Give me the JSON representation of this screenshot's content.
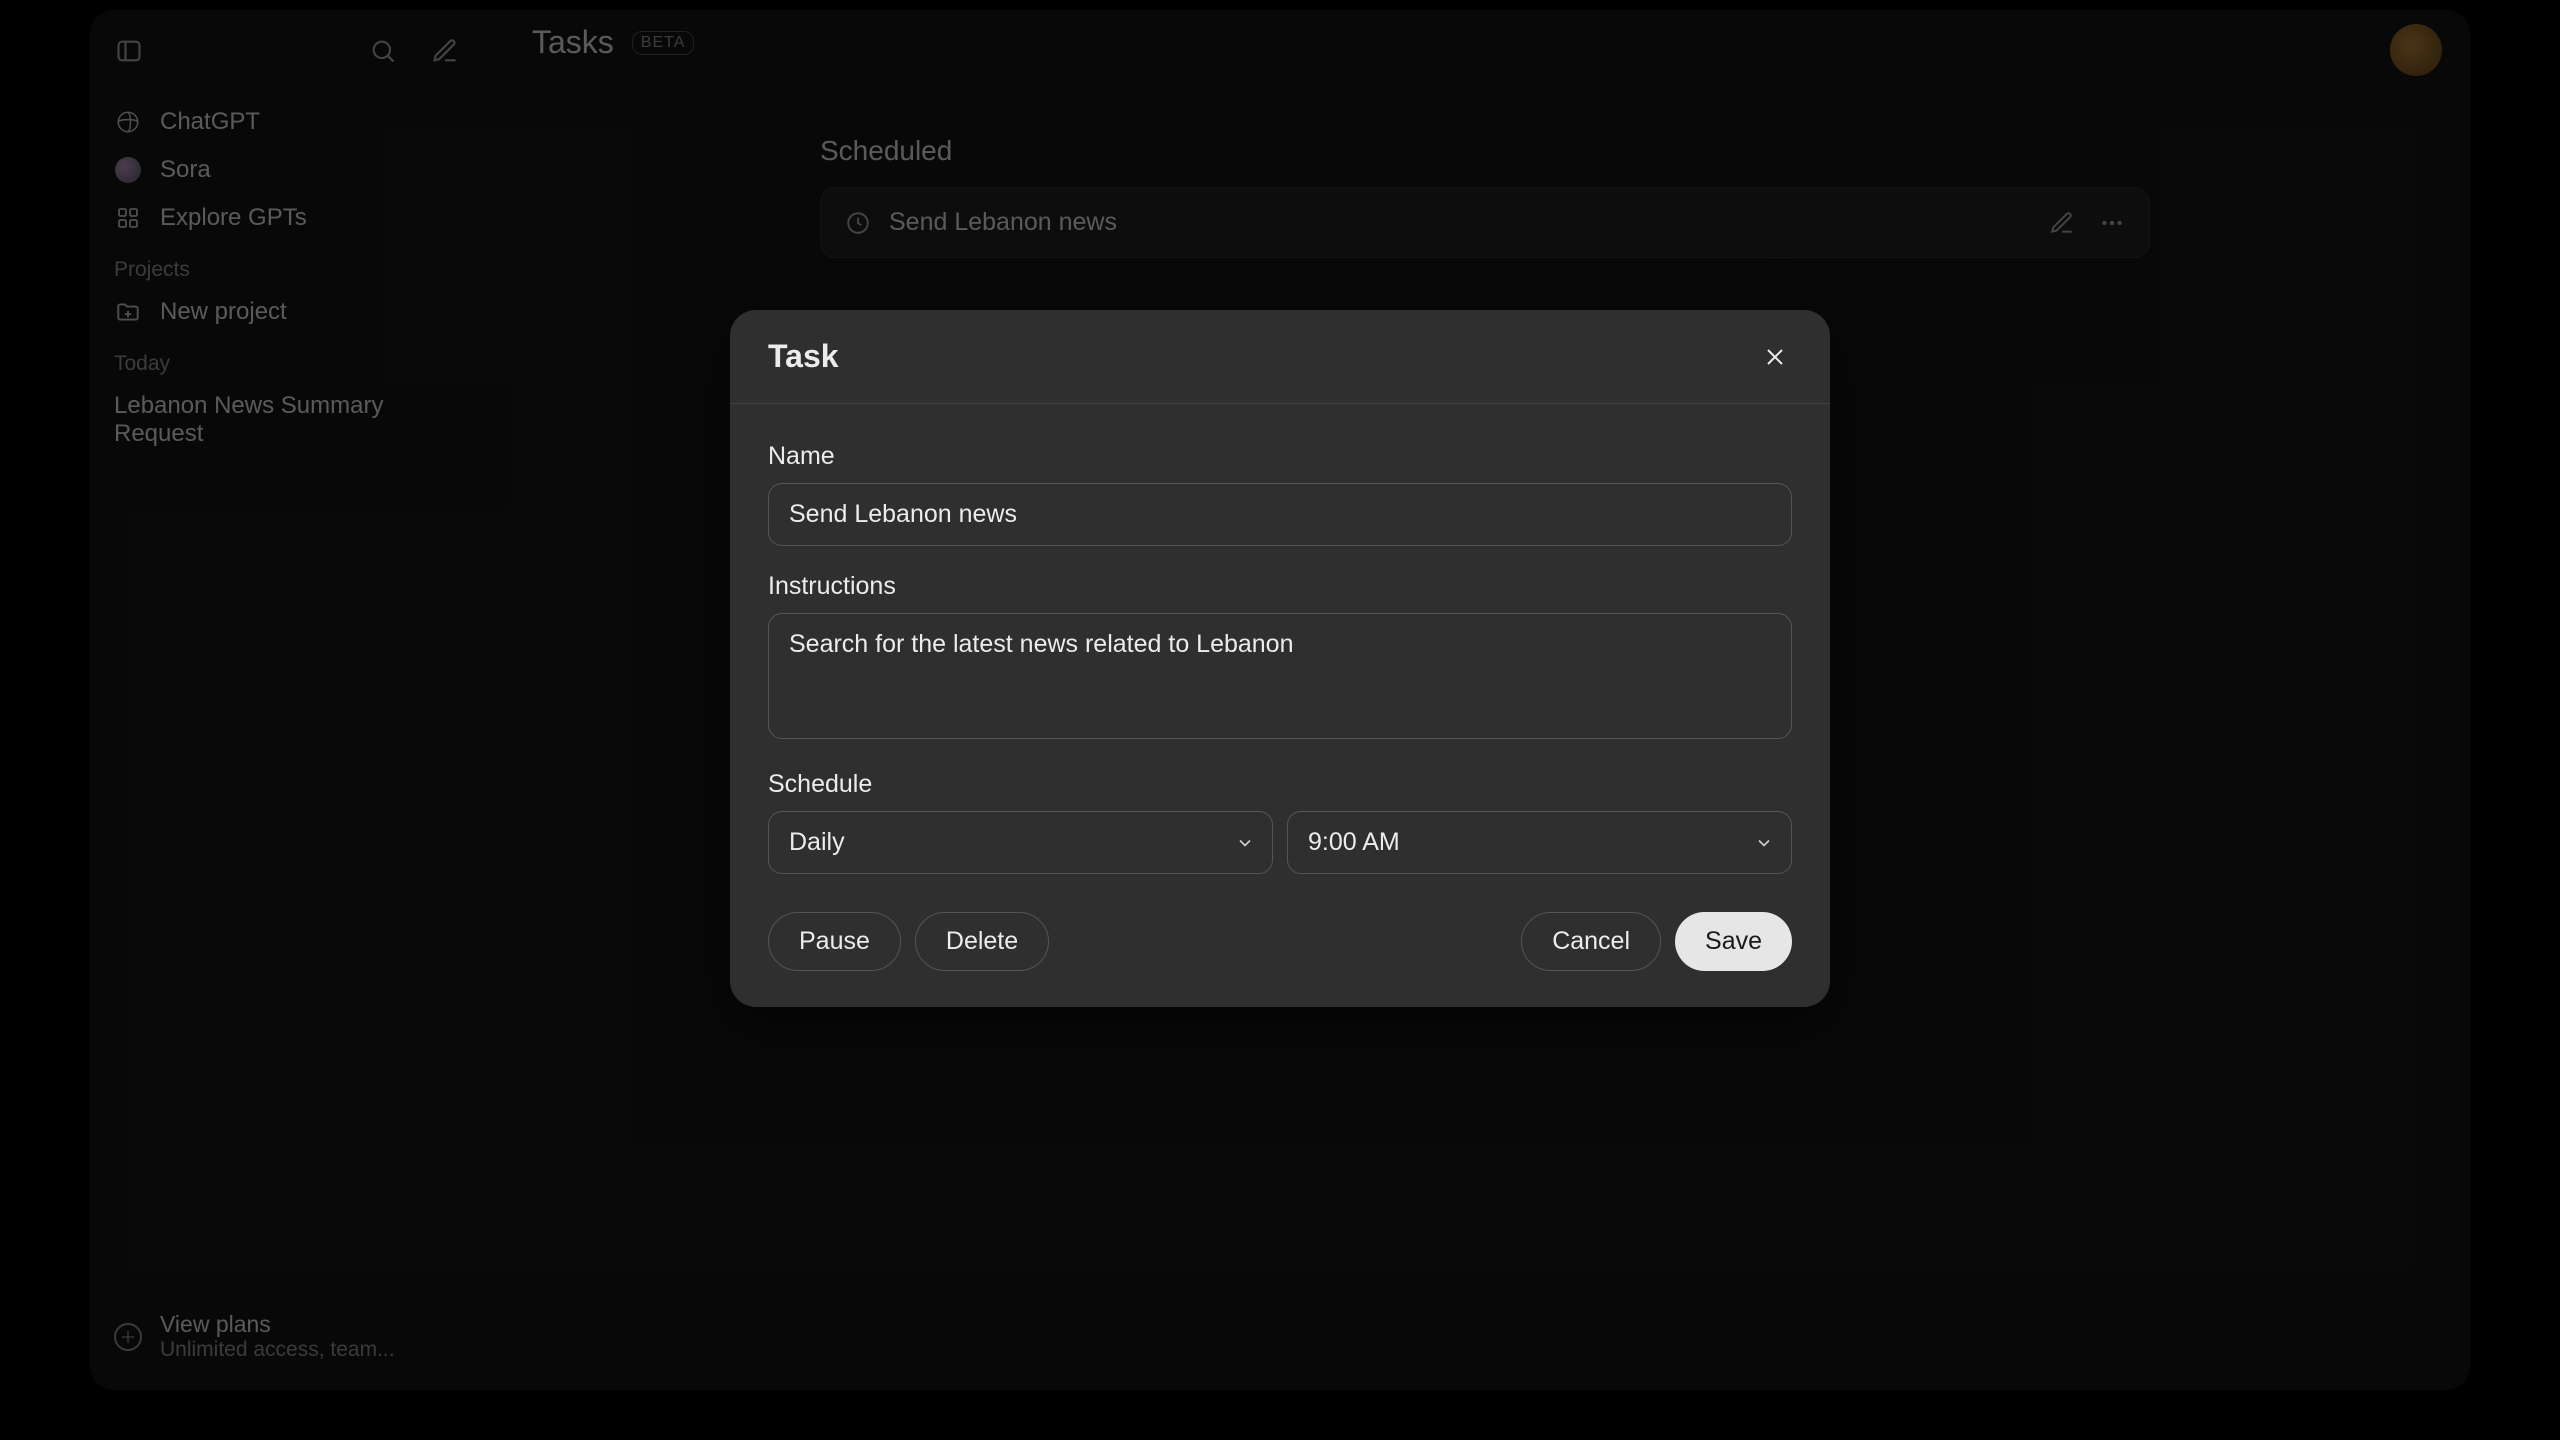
{
  "sidebar": {
    "nav": {
      "chatgpt": "ChatGPT",
      "sora": "Sora",
      "explore": "Explore GPTs"
    },
    "projects_label": "Projects",
    "new_project": "New project",
    "today_label": "Today",
    "history": [
      "Lebanon News Summary Request"
    ],
    "footer": {
      "title": "View plans",
      "subtitle": "Unlimited access, team..."
    }
  },
  "header": {
    "title": "Tasks",
    "badge": "BETA"
  },
  "scheduled": {
    "section_title": "Scheduled",
    "task_title": "Send Lebanon news"
  },
  "modal": {
    "title": "Task",
    "name_label": "Name",
    "name_value": "Send Lebanon news",
    "instructions_label": "Instructions",
    "instructions_value": "Search for the latest news related to Lebanon",
    "schedule_label": "Schedule",
    "frequency": "Daily",
    "time": "9:00 AM",
    "pause": "Pause",
    "delete": "Delete",
    "cancel": "Cancel",
    "save": "Save"
  }
}
